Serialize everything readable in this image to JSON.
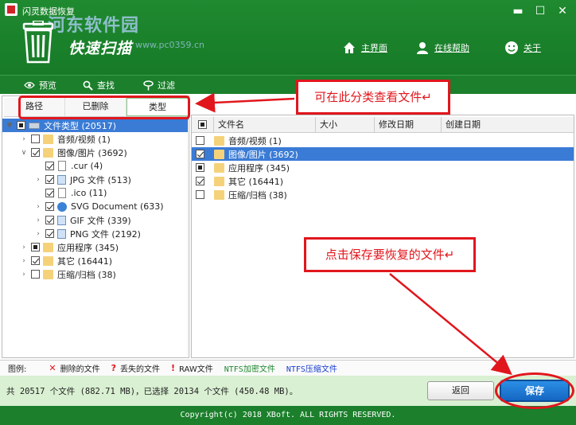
{
  "window": {
    "title": "闪灵数据恢复",
    "watermark": "河东软件园",
    "watermark_url": "www.pc0359.cn",
    "slogan": "快速扫描",
    "controls": {
      "minimize": "▬",
      "maximize": "☐",
      "close": "✕"
    }
  },
  "nav": {
    "home": "主界面",
    "help": "在线帮助",
    "about": "关于"
  },
  "toolbar": {
    "preview": "预览",
    "search": "查找",
    "filter": "过滤"
  },
  "tabs": [
    "路径",
    "已删除",
    "类型"
  ],
  "tree": {
    "root": "文件类型 (20517)",
    "items": [
      {
        "label": "音频/视频 (1)",
        "icon": "folder-icon",
        "check": "none",
        "depth": 1,
        "expand": "collapsed"
      },
      {
        "label": "图像/图片 (3692)",
        "icon": "folder-icon",
        "check": "checked",
        "depth": 1,
        "expand": "expanded"
      },
      {
        "label": ".cur (4)",
        "icon": "file-icon",
        "check": "checked",
        "depth": 2,
        "expand": "none"
      },
      {
        "label": "JPG 文件 (513)",
        "icon": "image-icon",
        "check": "checked",
        "depth": 2,
        "expand": "collapsed"
      },
      {
        "label": ".ico (11)",
        "icon": "file-icon",
        "check": "checked",
        "depth": 2,
        "expand": "none"
      },
      {
        "label": "SVG Document (633)",
        "icon": "svg-icon",
        "check": "checked",
        "depth": 2,
        "expand": "collapsed"
      },
      {
        "label": "GIF 文件 (339)",
        "icon": "image-icon",
        "check": "checked",
        "depth": 2,
        "expand": "collapsed"
      },
      {
        "label": "PNG 文件 (2192)",
        "icon": "image-icon",
        "check": "checked",
        "depth": 2,
        "expand": "collapsed"
      },
      {
        "label": "应用程序 (345)",
        "icon": "folder-icon",
        "check": "partial",
        "depth": 1,
        "expand": "collapsed"
      },
      {
        "label": "其它 (16441)",
        "icon": "folder-icon",
        "check": "checked",
        "depth": 1,
        "expand": "collapsed"
      },
      {
        "label": "压缩/归档 (38)",
        "icon": "folder-icon",
        "check": "none",
        "depth": 1,
        "expand": "collapsed"
      }
    ]
  },
  "table": {
    "columns": [
      "文件名",
      "大小",
      "修改日期",
      "创建日期"
    ],
    "rows": [
      {
        "name": "音频/视频 (1)",
        "check": "none"
      },
      {
        "name": "图像/图片 (3692)",
        "check": "checked"
      },
      {
        "name": "应用程序 (345)",
        "check": "partial"
      },
      {
        "name": "其它 (16441)",
        "check": "checked"
      },
      {
        "name": "压缩/归档 (38)",
        "check": "none"
      }
    ]
  },
  "legend": {
    "label": "图例:",
    "items": [
      {
        "mark": "✕",
        "text": "删除的文件",
        "color": "#e1161d"
      },
      {
        "mark": "?",
        "text": "丢失的文件",
        "color": "#e1161d"
      },
      {
        "mark": "!",
        "text": "RAW文件",
        "color": "#e1161d"
      },
      {
        "mark": "",
        "text": "NTFS加密文件",
        "color": "#1f8a30"
      },
      {
        "mark": "",
        "text": "NTFS压缩文件",
        "color": "#1a3fd0"
      }
    ]
  },
  "status": {
    "text": "共 20517 个文件 (882.71 MB)，已选择 20134 个文件 (450.48 MB)。"
  },
  "buttons": {
    "back": "返回",
    "save": "保存"
  },
  "footer": {
    "copyright": "Copyright(c) 2018 XBoft. ALL RIGHTS RESERVED."
  },
  "annotations": {
    "tab_hint": "可在此分类查看文件↵",
    "save_hint": "点击保存要恢复的文件↵"
  },
  "colors": {
    "header_green": "#1f8a30",
    "selection_blue": "#3a7bd5",
    "annotation_red": "#e1161d",
    "save_blue": "#1f7ad8"
  }
}
